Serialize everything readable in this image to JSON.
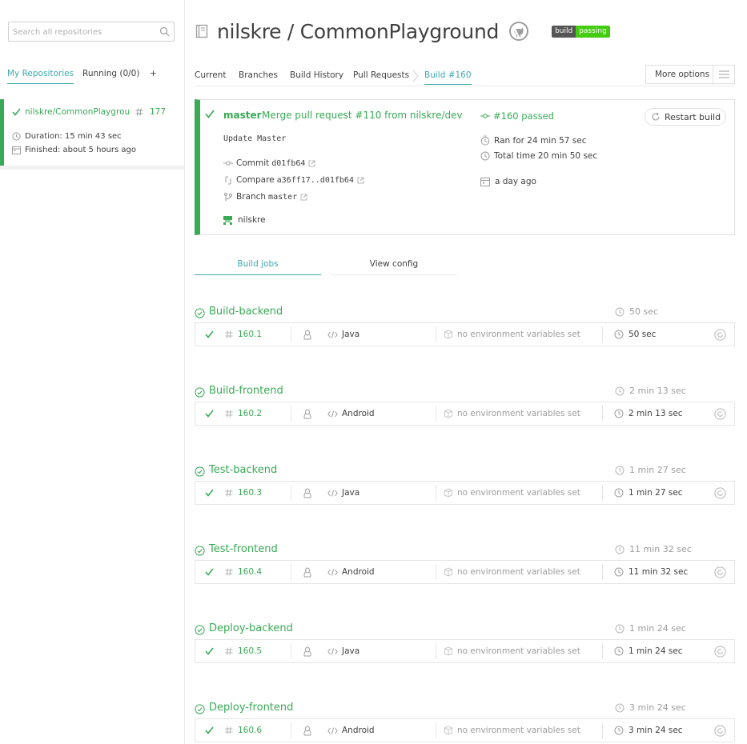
{
  "sidebar": {
    "search_placeholder": "Search all repositories",
    "tabs": {
      "my_repositories": "My Repositories",
      "running": "Running (0/0)",
      "add": "+"
    },
    "repo": {
      "name": "nilskre/CommonPlaygroung",
      "build_number": "177",
      "duration": "Duration: 15 min 43 sec",
      "finished": "Finished: about 5 hours ago",
      "status_color": "#39aa56"
    }
  },
  "header": {
    "repo_title": "nilskre / CommonPlayground",
    "badge": {
      "left": "build",
      "right": "passing",
      "color": "#4c1"
    }
  },
  "nav": {
    "tabs": [
      "Current",
      "Branches",
      "Build History",
      "Pull Requests"
    ],
    "active_tab": "Build #160",
    "more_options": "More options"
  },
  "build": {
    "branch": "master",
    "title": "Merge pull request #110 from nilskre/dev",
    "message": "Update Master",
    "commit_label": "Commit",
    "commit": "d01fb64",
    "compare_label": "Compare",
    "compare": "a36ff17..d01fb64",
    "branch_label": "Branch",
    "branch_name": "master",
    "author": "nilskre",
    "state": "#160 passed",
    "ran_for": "Ran for 24 min 57 sec",
    "total_time": "Total time 20 min 50 sec",
    "date": "a day ago",
    "restart": "Restart build"
  },
  "jobs_tabs": {
    "build_jobs": "Build jobs",
    "view_config": "View config"
  },
  "stages": [
    {
      "name": "Build-backend",
      "duration": "50 sec",
      "job": {
        "number": "160.1",
        "language": "Java",
        "env": "no environment variables set",
        "duration": "50 sec"
      }
    },
    {
      "name": "Build-frontend",
      "duration": "2 min 13 sec",
      "job": {
        "number": "160.2",
        "language": "Android",
        "env": "no environment variables set",
        "duration": "2 min 13 sec"
      }
    },
    {
      "name": "Test-backend",
      "duration": "1 min 27 sec",
      "job": {
        "number": "160.3",
        "language": "Java",
        "env": "no environment variables set",
        "duration": "1 min 27 sec"
      }
    },
    {
      "name": "Test-frontend",
      "duration": "11 min 32 sec",
      "job": {
        "number": "160.4",
        "language": "Android",
        "env": "no environment variables set",
        "duration": "11 min 32 sec"
      }
    },
    {
      "name": "Deploy-backend",
      "duration": "1 min 24 sec",
      "job": {
        "number": "160.5",
        "language": "Java",
        "env": "no environment variables set",
        "duration": "1 min 24 sec"
      }
    },
    {
      "name": "Deploy-frontend",
      "duration": "3 min 24 sec",
      "job": {
        "number": "160.6",
        "language": "Android",
        "env": "no environment variables set",
        "duration": "3 min 24 sec"
      }
    }
  ],
  "colors": {
    "passed": "#39aa56",
    "accent": "#3eaaaf",
    "muted": "#9d9d9d"
  }
}
